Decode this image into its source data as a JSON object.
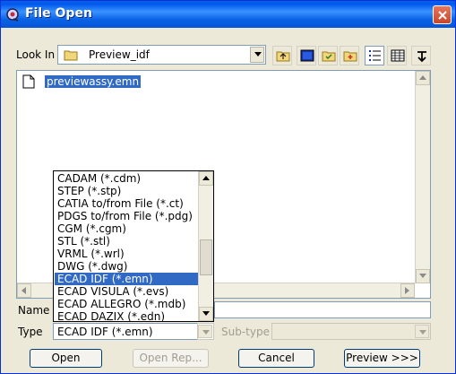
{
  "window": {
    "title": "File Open",
    "close_icon": "close-icon",
    "app_icon": "app-icon"
  },
  "lookin": {
    "label": "Look In",
    "folder_icon": "folder-icon",
    "value": "Preview_idf"
  },
  "toolbar": {
    "buttons": [
      "up-folder-icon",
      "desktop-icon",
      "favorites-icon",
      "new-folder-icon",
      "list-view-icon",
      "details-view-icon",
      "sort-icon"
    ]
  },
  "files": [
    {
      "name": "previewassy.emn",
      "icon": "file-icon",
      "selected": true
    }
  ],
  "name_field": {
    "label": "Name",
    "value": ""
  },
  "type_field": {
    "label": "Type",
    "value": "ECAD IDF (*.emn)"
  },
  "subtype": {
    "label": "Sub-type",
    "value": ""
  },
  "type_options": [
    "CADAM (*.cdm)",
    "STEP (*.stp)",
    "CATIA to/from File (*.ct)",
    "PDGS to/from File (*.pdg)",
    "CGM (*.cgm)",
    "STL (*.stl)",
    "VRML (*.wrl)",
    "DWG (*.dwg)",
    "ECAD IDF (*.emn)",
    "ECAD VISULA (*.evs)",
    "ECAD ALLEGRO (*.mdb)",
    "ECAD DAZIX (*.edn)"
  ],
  "type_selected_index": 8,
  "buttons": {
    "open": "Open",
    "open_rep": "Open Rep...",
    "cancel": "Cancel",
    "preview": "Preview >>>"
  }
}
